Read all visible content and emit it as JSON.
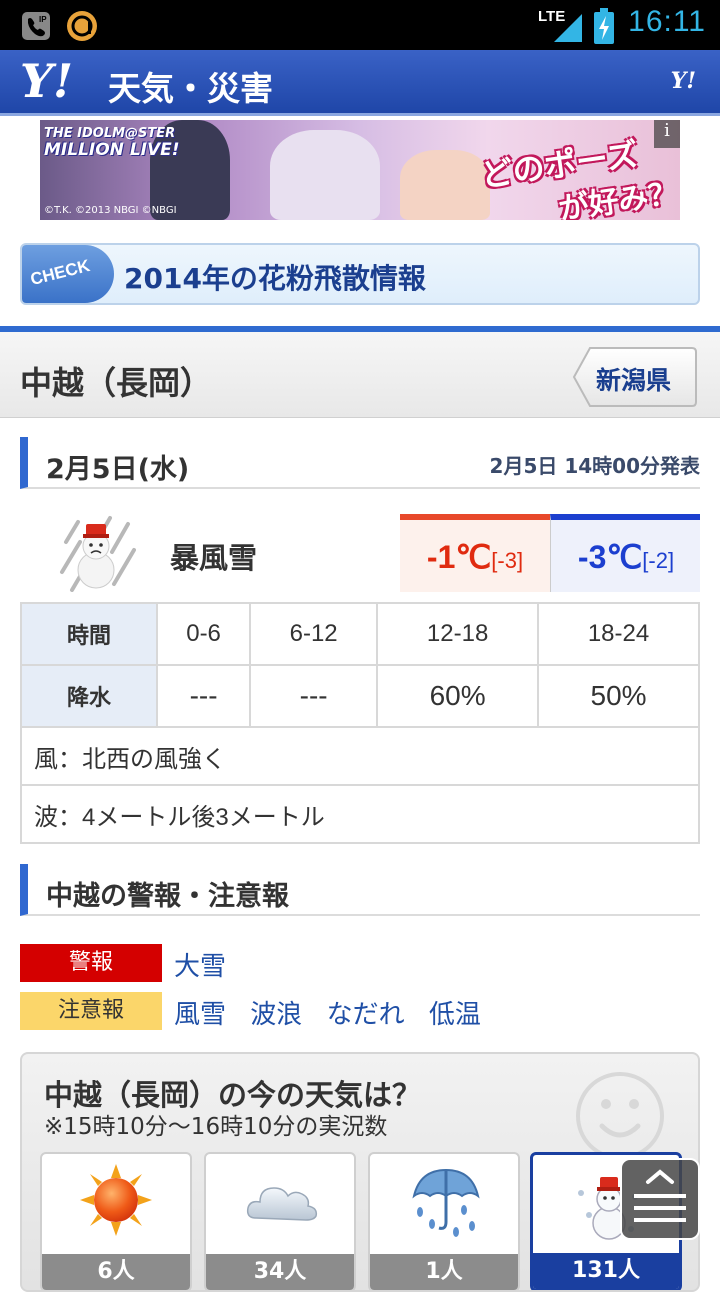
{
  "status_bar": {
    "time": "16:11",
    "network": "LTE",
    "icons": [
      "ip-phone-icon",
      "app-a-icon",
      "signal-icon",
      "battery-charging-icon"
    ]
  },
  "header": {
    "logo": "Y!",
    "title": "天気・災害",
    "small_logo": "Y!"
  },
  "ad": {
    "logo_line1": "THE IDOLM@STER",
    "logo_line2": "MILLION LIVE!",
    "copyright": "©T.K. ©2013 NBGI ©NBGI",
    "catch1": "どのポーズ",
    "catch2": "が好み？",
    "info_icon": "i"
  },
  "check_banner": {
    "tag": "CHECK",
    "text": "2014年の花粉飛散情報"
  },
  "location": {
    "title": "中越（長岡）",
    "prefecture_button": "新潟県"
  },
  "forecast": {
    "date": "2月5日(水)",
    "published": "2月5日 14時00分発表",
    "weather": "暴風雪",
    "weather_icon": "snowman-storm-icon",
    "high": "-1℃",
    "high_diff": "[-3]",
    "low": "-3℃",
    "low_diff": "[-2]",
    "time_header": "時間",
    "precip_header": "降水",
    "periods": [
      "0-6",
      "6-12",
      "12-18",
      "18-24"
    ],
    "precip": [
      "---",
      "---",
      "60%",
      "50%"
    ],
    "wind": "風：北西の風強く",
    "wave": "波：4メートル後3メートル"
  },
  "alerts": {
    "heading": "中越の警報・注意報",
    "warning_label": "警報",
    "warnings": [
      "大雪"
    ],
    "advisory_label": "注意報",
    "advisories": [
      "風雪",
      "波浪",
      "なだれ",
      "低温"
    ]
  },
  "poll": {
    "title": "中越（長岡）の今の天気は？",
    "subtitle": "※15時10分～16時10分の実況数",
    "options": [
      {
        "icon": "sun-icon",
        "count": "6人"
      },
      {
        "icon": "cloud-icon",
        "count": "34人"
      },
      {
        "icon": "umbrella-rain-icon",
        "count": "1人"
      },
      {
        "icon": "snowman-icon",
        "count": "131人"
      }
    ]
  },
  "colors": {
    "brand_blue": "#2f6bd0",
    "warning_red": "#d40000",
    "advisory_yellow": "#fbd66a",
    "temp_high": "#e02b10",
    "temp_low": "#1c3fcf"
  }
}
